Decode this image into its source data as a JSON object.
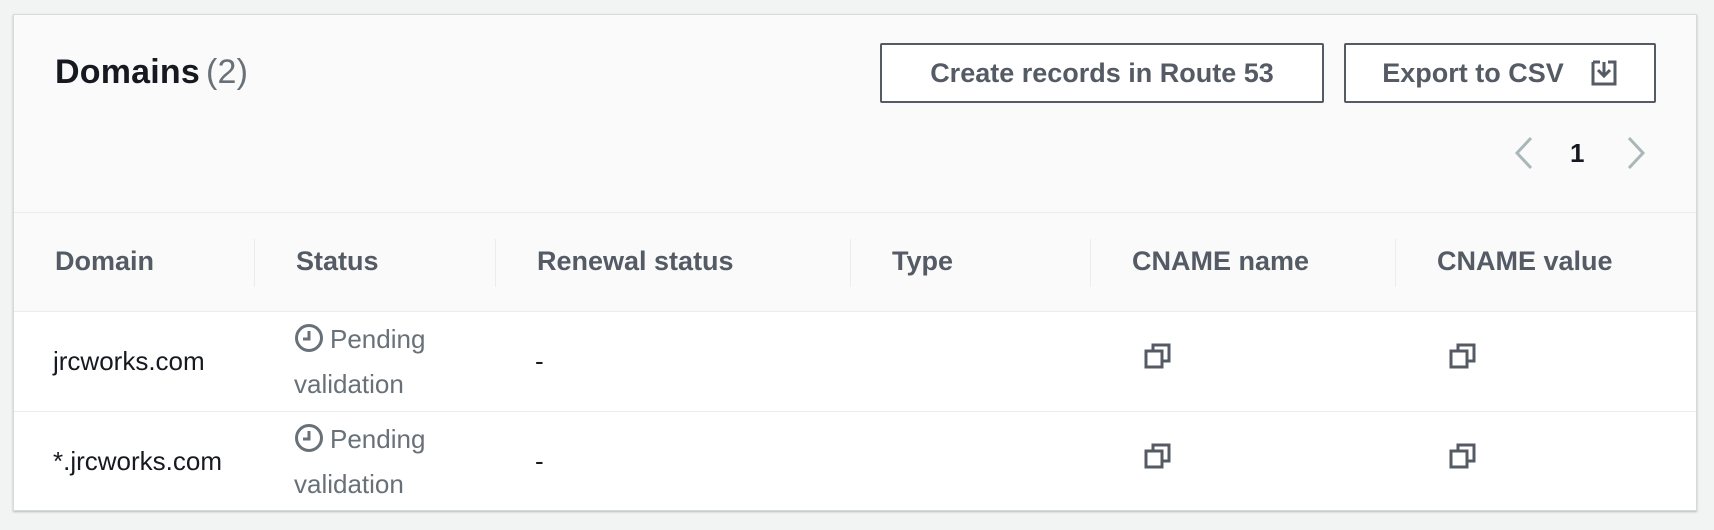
{
  "header": {
    "title": "Domains",
    "count": "(2)",
    "create_records_label": "Create records in Route 53",
    "export_label": "Export to CSV",
    "export_icon": "download-icon"
  },
  "pagination": {
    "current_page": "1",
    "prev_icon": "chevron-left-icon",
    "next_icon": "chevron-right-icon"
  },
  "table": {
    "columns": [
      "Domain",
      "Status",
      "Renewal status",
      "Type",
      "CNAME name",
      "CNAME value"
    ],
    "rows": [
      {
        "domain": "jrcworks.com",
        "status": "Pending validation",
        "status_icon": "clock-icon",
        "renewal_status": "-",
        "type": "",
        "cname_name_icon": "copy-icon",
        "cname_value_icon": "copy-icon"
      },
      {
        "domain": "*.jrcworks.com",
        "status": "Pending validation",
        "status_icon": "clock-icon",
        "renewal_status": "-",
        "type": "",
        "cname_name_icon": "copy-icon",
        "cname_value_icon": "copy-icon"
      }
    ]
  },
  "colors": {
    "text_primary": "#16191f",
    "text_secondary": "#687078",
    "button_border": "#545b64",
    "pager_chevron": "#aab7b8"
  }
}
